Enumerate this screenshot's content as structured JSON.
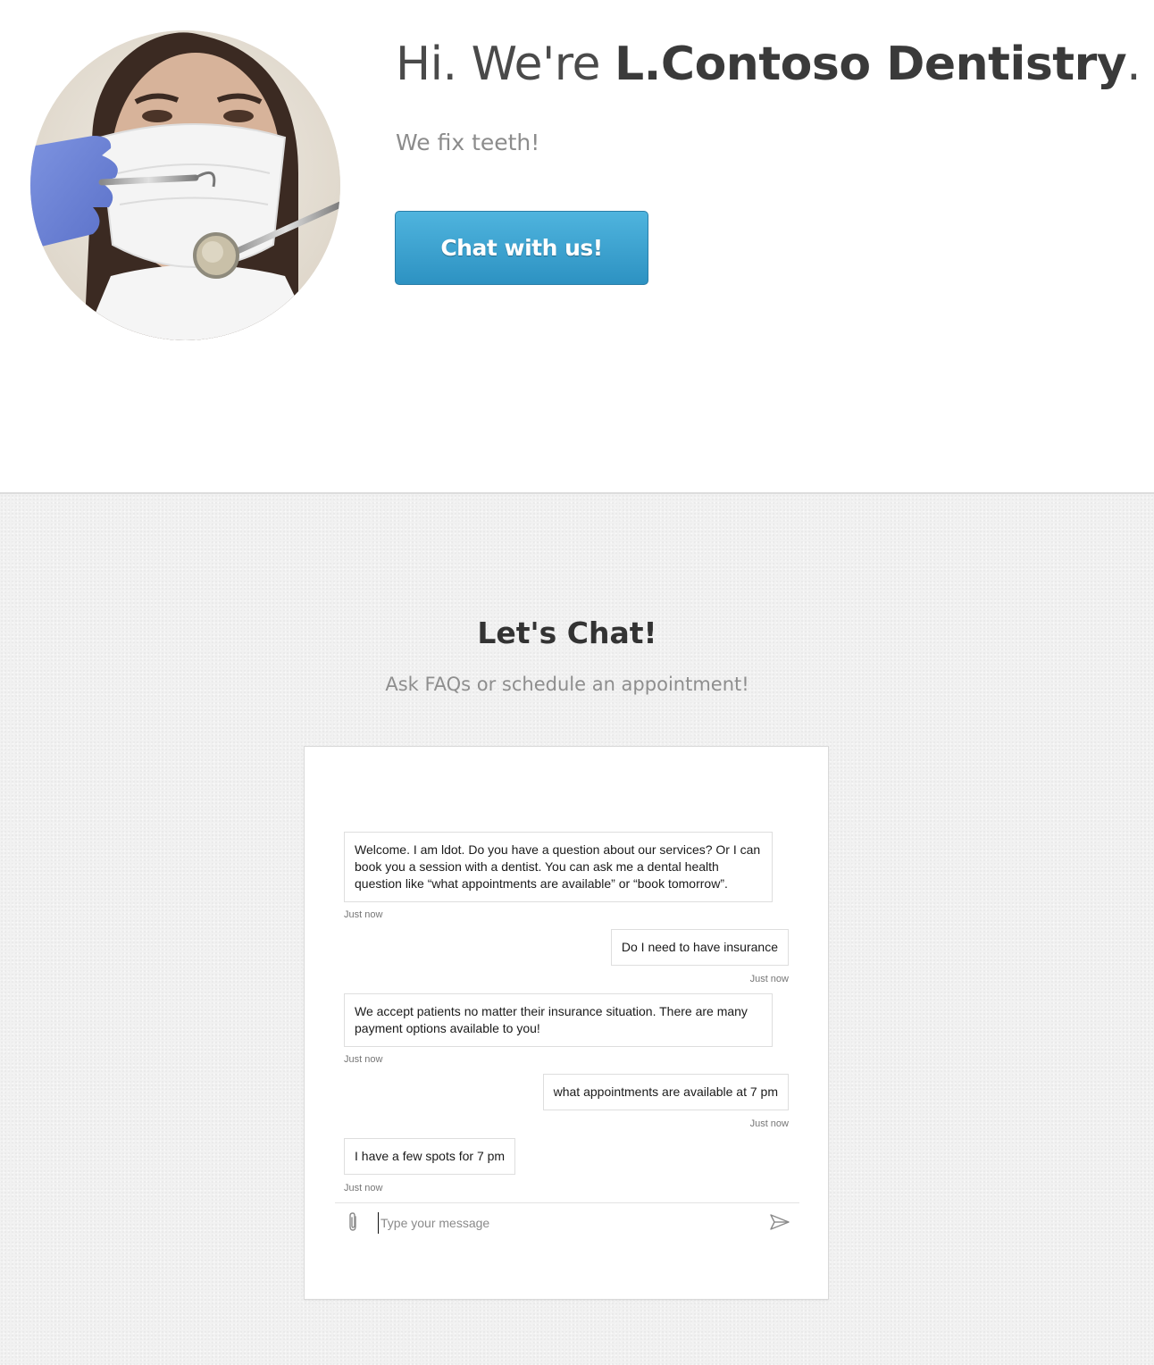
{
  "hero": {
    "greeting": "Hi. We're ",
    "brand": "L.Contoso Dentistry",
    "period": ".",
    "tagline": "We fix teeth!",
    "cta_label": "Chat with us!",
    "photo_icon": "dentist-with-tools-photo"
  },
  "chat_section": {
    "title": "Let's Chat!",
    "subtitle": "Ask FAQs or schedule an appointment!"
  },
  "chat": {
    "messages": [
      {
        "from": "bot",
        "text": "Welcome. I am ldot. Do you have a question about our services? Or I can book you a session with a dentist. You can ask me a dental health question like “what appointments are available” or “book tomorrow”.",
        "time": "Just now"
      },
      {
        "from": "user",
        "text": "Do I need to have insurance",
        "time": "Just now"
      },
      {
        "from": "bot",
        "text": "We accept patients no matter their insurance situation. There are many payment options available to you!",
        "time": "Just now"
      },
      {
        "from": "user",
        "text": "what appointments are available at 7 pm",
        "time": "Just now"
      },
      {
        "from": "bot",
        "text": "I have a few spots for 7 pm",
        "time": "Just now"
      }
    ],
    "input_placeholder": "Type your message",
    "input_value": "",
    "attach_icon": "paperclip-icon",
    "send_icon": "send-arrow-icon"
  },
  "colors": {
    "cta_top": "#4fb4de",
    "cta_bottom": "#2d92c2",
    "section_bg": "#f1f1f1"
  }
}
